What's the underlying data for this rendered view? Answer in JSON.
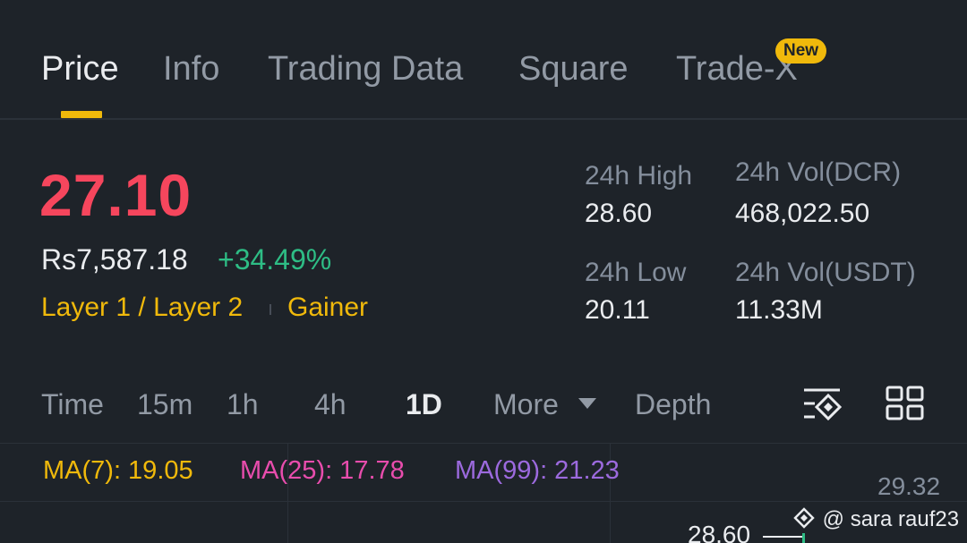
{
  "tabs": [
    {
      "label": "Price",
      "active": true
    },
    {
      "label": "Info",
      "active": false
    },
    {
      "label": "Trading Data",
      "active": false
    },
    {
      "label": "Square",
      "active": false
    },
    {
      "label": "Trade-X",
      "active": false,
      "badge": "New"
    }
  ],
  "ticker": {
    "last_price": "27.10",
    "fiat_value": "Rs7,587.18",
    "change_pct": "+34.49%",
    "tags": [
      "Layer 1 / Layer 2",
      "Gainer"
    ]
  },
  "stats": {
    "high_label": "24h High",
    "high_value": "28.60",
    "vol_base_label": "24h Vol(DCR)",
    "vol_base_value": "468,022.50",
    "low_label": "24h Low",
    "low_value": "20.11",
    "vol_quote_label": "24h Vol(USDT)",
    "vol_quote_value": "11.33M"
  },
  "chart_controls": {
    "intervals": [
      "Time",
      "15m",
      "1h",
      "4h",
      "1D"
    ],
    "active_interval": "1D",
    "more_label": "More",
    "depth_label": "Depth",
    "icons": [
      "chart-settings-icon",
      "grid-layout-icon"
    ]
  },
  "indicators": [
    {
      "label": "MA(7): 19.05",
      "color": "#f0b90b"
    },
    {
      "label": "MA(25): 17.78",
      "color": "#e84dad"
    },
    {
      "label": "MA(99): 21.23",
      "color": "#9c6ade"
    }
  ],
  "chart": {
    "axis_top_label": "29.32",
    "high_marker": "28.60",
    "watermark": "@ sara rauf23"
  },
  "colors": {
    "background": "#1e2329",
    "accent": "#f0b90b",
    "down": "#f6465d",
    "up": "#2ebd85"
  }
}
